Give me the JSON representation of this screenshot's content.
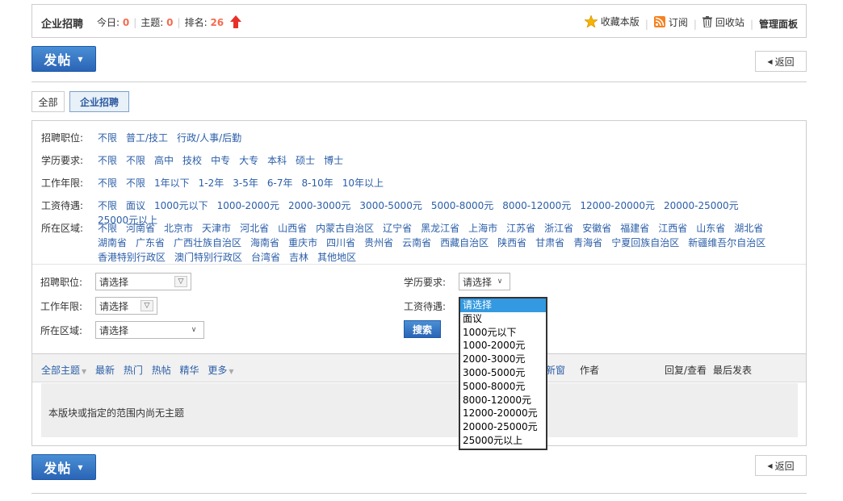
{
  "header": {
    "title": "企业招聘",
    "stats": [
      {
        "label": "今日:",
        "value": "0"
      },
      {
        "label": "主题:",
        "value": "0"
      },
      {
        "label": "排名:",
        "value": "26"
      }
    ],
    "links": {
      "favorite": "收藏本版",
      "subscribe": "订阅",
      "recycle": "回收站",
      "manage": "管理面板"
    }
  },
  "actions": {
    "post": "发帖",
    "back": "返回"
  },
  "tabs": [
    "全部",
    "企业招聘"
  ],
  "filters": [
    {
      "label": "招聘职位:",
      "options": [
        "不限",
        "普工/技工",
        "行政/人事/后勤"
      ]
    },
    {
      "label": "学历要求:",
      "options": [
        "不限",
        "不限",
        "高中",
        "技校",
        "中专",
        "大专",
        "本科",
        "硕士",
        "博士"
      ]
    },
    {
      "label": "工作年限:",
      "options": [
        "不限",
        "不限",
        "1年以下",
        "1-2年",
        "3-5年",
        "6-7年",
        "8-10年",
        "10年以上"
      ]
    },
    {
      "label": "工资待遇:",
      "options": [
        "不限",
        "面议",
        "1000元以下",
        "1000-2000元",
        "2000-3000元",
        "3000-5000元",
        "5000-8000元",
        "8000-12000元",
        "12000-20000元",
        "20000-25000元",
        "25000元以上"
      ]
    },
    {
      "label": "所在区域:",
      "options": [
        "不限",
        "河南省",
        "北京市",
        "天津市",
        "河北省",
        "山西省",
        "内蒙古自治区",
        "辽宁省",
        "黑龙江省",
        "上海市",
        "江苏省",
        "浙江省",
        "安徽省",
        "福建省",
        "江西省",
        "山东省",
        "湖北省",
        "湖南省",
        "广东省",
        "广西壮族自治区",
        "海南省",
        "重庆市",
        "四川省",
        "贵州省",
        "云南省",
        "西藏自治区",
        "陕西省",
        "甘肃省",
        "青海省",
        "宁夏回族自治区",
        "新疆维吾尔自治区",
        "香港特别行政区",
        "澳门特别行政区",
        "台湾省",
        "吉林",
        "其他地区"
      ]
    }
  ],
  "selects": {
    "position": {
      "label": "招聘职位:",
      "value": "请选择"
    },
    "education": {
      "label": "学历要求:",
      "value": "请选择"
    },
    "experience": {
      "label": "工作年限:",
      "value": "请选择"
    },
    "salary": {
      "label": "工资待遇:",
      "value": "请选择"
    },
    "region": {
      "label": "所在区域:",
      "value": "请选择"
    },
    "search": "搜索"
  },
  "salary_dropdown": [
    "请选择",
    "面议",
    "1000元以下",
    "1000-2000元",
    "2000-3000元",
    "3000-5000元",
    "5000-8000元",
    "8000-12000元",
    "12000-20000元",
    "20000-25000元",
    "25000元以上"
  ],
  "thread_header": {
    "all": "全部主题",
    "latest": "最新",
    "hot": "热门",
    "hot_posts": "热帖",
    "digest": "精华",
    "more": "更多",
    "new_window": "新窗",
    "author": "作者",
    "replies": "回复/查看",
    "last_post": "最后发表"
  },
  "empty_message": "本版块或指定的范围内尚无主题",
  "colors": {
    "accent": "#2b5ea8",
    "stat_number": "#f26c4f",
    "button": "#2a64b6"
  }
}
